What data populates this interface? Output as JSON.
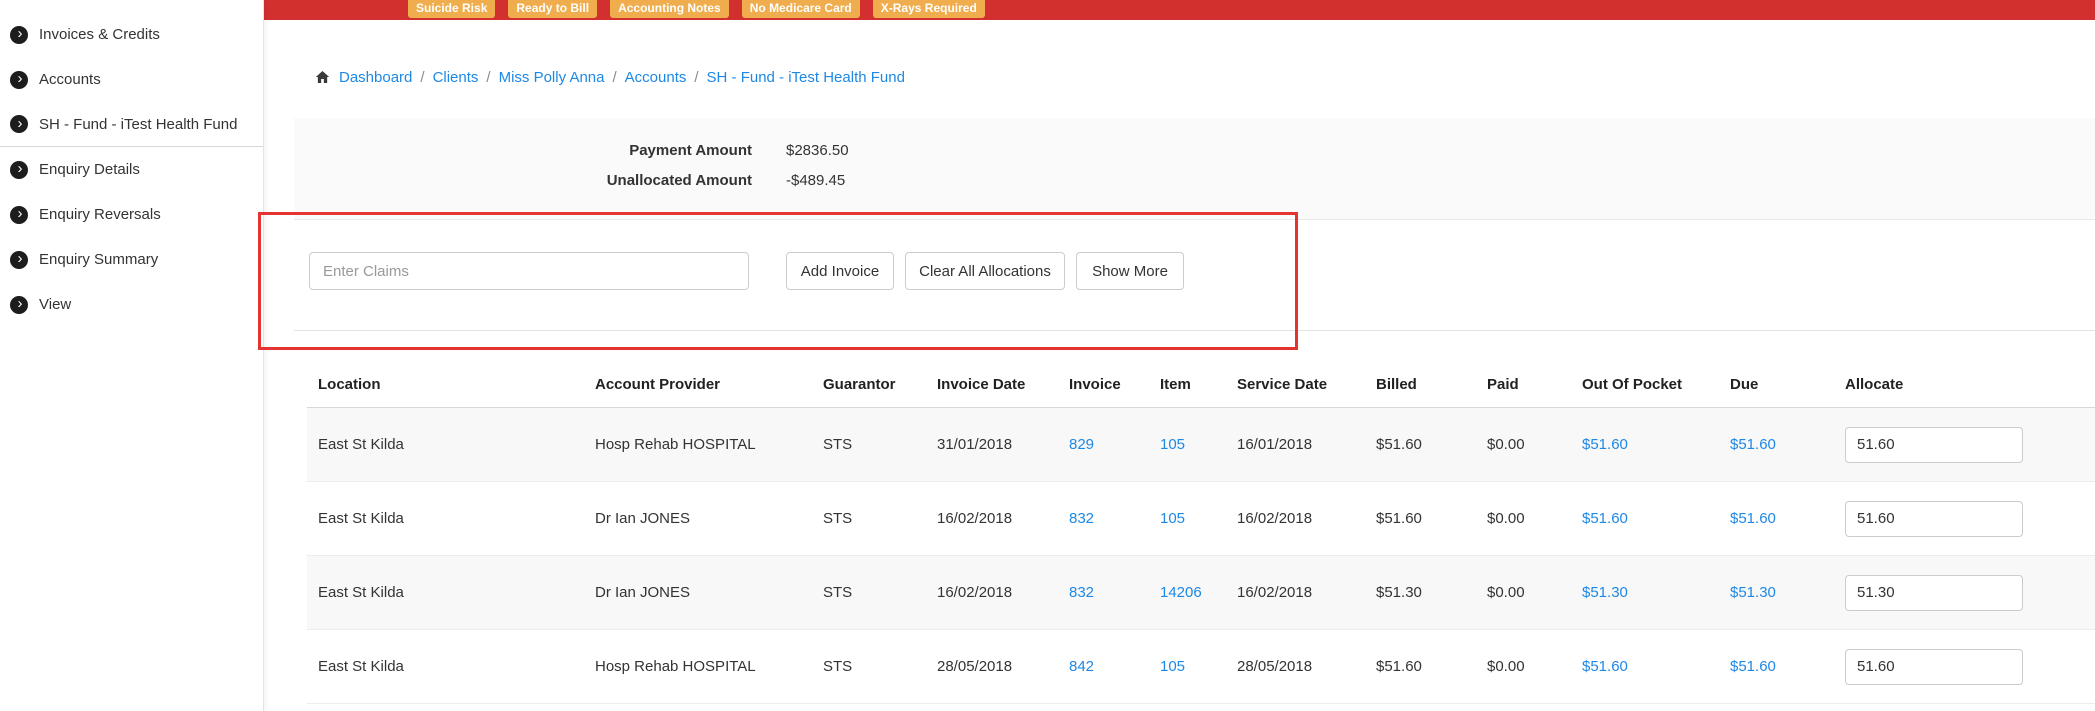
{
  "colors": {
    "topbar_red": "#d2302e",
    "badge_orange": "#f0ad4e",
    "link_blue": "#1e88e5",
    "annotation_red": "#e5342f"
  },
  "icons": {
    "chevron": "›"
  },
  "topbar": {
    "badges": [
      "Suicide Risk",
      "Ready to Bill",
      "Accounting Notes",
      "No Medicare Card",
      "X-Rays Required"
    ]
  },
  "sidebar": {
    "items": [
      {
        "label": "Invoices & Credits"
      },
      {
        "label": "Accounts"
      },
      {
        "label": "SH - Fund - iTest Health Fund"
      },
      {
        "label": "Enquiry Details"
      },
      {
        "label": "Enquiry Reversals"
      },
      {
        "label": "Enquiry Summary"
      },
      {
        "label": "View"
      }
    ]
  },
  "breadcrumb": {
    "separator": "/",
    "items": [
      "Dashboard",
      "Clients",
      "Miss Polly Anna",
      "Accounts",
      "SH - Fund - iTest Health Fund"
    ]
  },
  "summary": {
    "payment_label": "Payment Amount",
    "payment_value": "$2836.50",
    "unallocated_label": "Unallocated Amount",
    "unallocated_value": "-$489.45"
  },
  "claims": {
    "input_placeholder": "Enter Claims",
    "buttons": [
      "Add Invoice",
      "Clear All Allocations",
      "Show More"
    ]
  },
  "table": {
    "columns": [
      "Location",
      "Account Provider",
      "Guarantor",
      "Invoice Date",
      "Invoice",
      "Item",
      "Service Date",
      "Billed",
      "Paid",
      "Out Of Pocket",
      "Due",
      "Allocate"
    ],
    "rows": [
      {
        "location": "East St Kilda",
        "provider": "Hosp Rehab HOSPITAL",
        "guarantor": "STS",
        "invoice_date": "31/01/2018",
        "invoice": "829",
        "item": "105",
        "service_date": "16/01/2018",
        "billed": "$51.60",
        "paid": "$0.00",
        "out_of_pocket": "$51.60",
        "due": "$51.60",
        "allocate": "51.60"
      },
      {
        "location": "East St Kilda",
        "provider": "Dr Ian JONES",
        "guarantor": "STS",
        "invoice_date": "16/02/2018",
        "invoice": "832",
        "item": "105",
        "service_date": "16/02/2018",
        "billed": "$51.60",
        "paid": "$0.00",
        "out_of_pocket": "$51.60",
        "due": "$51.60",
        "allocate": "51.60"
      },
      {
        "location": "East St Kilda",
        "provider": "Dr Ian JONES",
        "guarantor": "STS",
        "invoice_date": "16/02/2018",
        "invoice": "832",
        "item": "14206",
        "service_date": "16/02/2018",
        "billed": "$51.30",
        "paid": "$0.00",
        "out_of_pocket": "$51.30",
        "due": "$51.30",
        "allocate": "51.30"
      },
      {
        "location": "East St Kilda",
        "provider": "Hosp Rehab HOSPITAL",
        "guarantor": "STS",
        "invoice_date": "28/05/2018",
        "invoice": "842",
        "item": "105",
        "service_date": "28/05/2018",
        "billed": "$51.60",
        "paid": "$0.00",
        "out_of_pocket": "$51.60",
        "due": "$51.60",
        "allocate": "51.60"
      }
    ]
  }
}
